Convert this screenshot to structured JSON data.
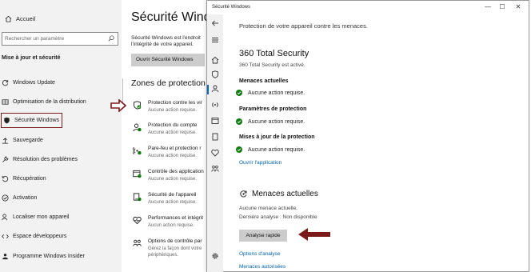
{
  "sidebar": {
    "home_label": "Accueil",
    "search_placeholder": "Rechercher un paramètre",
    "section_title": "Mise à jour et sécurité",
    "items": [
      {
        "label": "Windows Update",
        "icon": "refresh-icon"
      },
      {
        "label": "Optimisation de la distribution",
        "icon": "delivery-icon"
      },
      {
        "label": "Sécurité Windows",
        "icon": "shield-icon",
        "active": true
      },
      {
        "label": "Sauvegarde",
        "icon": "backup-icon"
      },
      {
        "label": "Résolution des problèmes",
        "icon": "wrench-icon"
      },
      {
        "label": "Récupération",
        "icon": "recovery-icon"
      },
      {
        "label": "Activation",
        "icon": "check-circle-icon"
      },
      {
        "label": "Localiser mon appareil",
        "icon": "person-location-icon"
      },
      {
        "label": "Espace développeurs",
        "icon": "developer-icon"
      },
      {
        "label": "Programme Windows Insider",
        "icon": "insider-icon"
      }
    ]
  },
  "background_page": {
    "title": "Sécurité Windows",
    "description": "Sécurité Windows est l'endroit l'intégrité de votre appareil.",
    "open_button": "Ouvrir Sécurité Windows",
    "zones_title": "Zones de protection",
    "zones": [
      {
        "title": "Protection contre les vir",
        "status": "Aucune action requise.",
        "icon": "shield-virus-icon"
      },
      {
        "title": "Protection du compte",
        "status": "Aucune action requise.",
        "icon": "account-icon"
      },
      {
        "title": "Pare-feu et protection r",
        "status": "Aucune action requise.",
        "icon": "firewall-icon"
      },
      {
        "title": "Contrôle des application",
        "status": "Aucune action requise.",
        "icon": "app-browser-icon"
      },
      {
        "title": "Sécurité de l'appareil",
        "status": "Aucune action requise.",
        "icon": "device-icon"
      },
      {
        "title": "Performances et intégrit",
        "status": "Aucun action requise.",
        "icon": "heart-icon"
      },
      {
        "title": "Options de contrôle par",
        "status": "Gérez la façon dont votre périphériques.",
        "icon": "family-icon"
      }
    ]
  },
  "security_window": {
    "title": "Sécurité Windows",
    "controls": {
      "minimize": "—",
      "maximize": "☐",
      "close": "✕"
    },
    "heading": "Protection de votre appareil contre les menaces.",
    "provider_name": "360 Total Security",
    "provider_status": "360 Total Security est activé.",
    "sections": [
      {
        "title": "Menaces actuelles",
        "status": "Aucune action requise."
      },
      {
        "title": "Paramètres de protection",
        "status": "Aucune action requise."
      },
      {
        "title": "Mises à jour de la protection",
        "status": "Aucune action requise."
      }
    ],
    "open_app_link": "Ouvrir l'application",
    "threats_title": "Menaces actuelles",
    "no_threats": "Aucune menace actuelle.",
    "last_scan": "Dernière analyse : Non disponible",
    "quick_scan_button": "Analyse rapide",
    "analysis_options_link": "Options d'analyse",
    "allowed_threats_link": "Menaces autorisées"
  },
  "colors": {
    "accent_link": "#0063b1",
    "ok_green": "#107c10",
    "annotation_red": "#7b1a1a"
  }
}
